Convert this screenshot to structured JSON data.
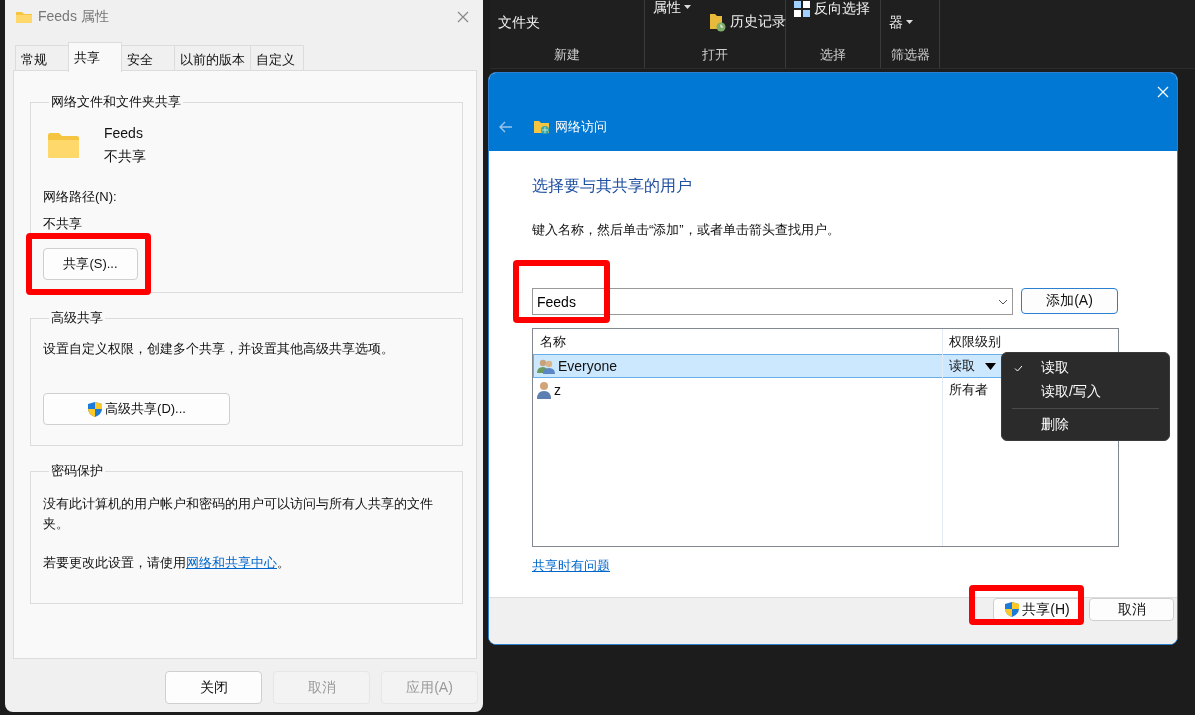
{
  "ribbon": {
    "groups": [
      {
        "label": "新建",
        "buttons": [
          {
            "kind": "large",
            "lines": [
              "文件夹"
            ],
            "caret": false
          }
        ]
      },
      {
        "label": "打开",
        "buttons": [
          {
            "kind": "large",
            "lines": [
              "属性"
            ],
            "caret": true
          },
          {
            "kind": "small",
            "label": "历史记录"
          }
        ]
      },
      {
        "label": "选择",
        "buttons": [
          {
            "kind": "small",
            "label": "反向选择"
          }
        ]
      },
      {
        "label": "筛选器",
        "buttons": [
          {
            "kind": "large",
            "lines": [
              "器"
            ],
            "caret": true
          }
        ]
      }
    ]
  },
  "properties_dialog": {
    "title": "Feeds 属性",
    "tabs": [
      {
        "label": "常规",
        "selected": false
      },
      {
        "label": "共享",
        "selected": true
      },
      {
        "label": "安全",
        "selected": false
      },
      {
        "label": "以前的版本",
        "selected": false
      },
      {
        "label": "自定义",
        "selected": false
      }
    ],
    "sharing_group": {
      "legend": "网络文件和文件夹共享",
      "item_name": "Feeds",
      "item_status": "不共享",
      "path_label": "网络路径(N):",
      "path_value": "不共享",
      "button": {
        "label": "共享(S)...",
        "highlighted": true
      }
    },
    "advanced_group": {
      "legend": "高级共享",
      "description": "设置自定义权限，创建多个共享，并设置其他高级共享选项。",
      "button": {
        "label": "高级共享(D)...",
        "shield": true
      }
    },
    "password_group": {
      "legend": "密码保护",
      "text": "没有此计算机的用户帐户和密码的用户可以访问与所有人共享的文件夹。",
      "note_before": "若要更改此设置，请使用",
      "link": "网络和共享中心",
      "note_after": "。"
    },
    "buttons": [
      {
        "label": "关闭",
        "disabled": false
      },
      {
        "label": "取消",
        "disabled": true
      },
      {
        "label": "应用(A)",
        "disabled": true
      }
    ]
  },
  "share_dialog": {
    "title": "网络访问",
    "heading": "选择要与其共享的用户",
    "instruction": "键入名称，然后单击“添加”，或者单击箭头查找用户。",
    "name_field": {
      "value": "Feeds",
      "highlighted": true
    },
    "add_button": "添加(A)",
    "columns": [
      "名称",
      "权限级别"
    ],
    "rows": [
      {
        "kind": "group",
        "name": "Everyone",
        "permission": "读取",
        "dropdown": true,
        "selected": true
      },
      {
        "kind": "user",
        "name": "z",
        "permission": "所有者",
        "dropdown": false,
        "selected": false
      }
    ],
    "menu": {
      "items": [
        {
          "label": "读取",
          "checked": true,
          "separator_before": false
        },
        {
          "label": "读取/写入",
          "checked": false,
          "separator_before": false
        },
        {
          "label": "删除",
          "checked": false,
          "separator_before": true
        }
      ]
    },
    "link": "共享时有问题",
    "buttons": [
      {
        "label": "共享(H)",
        "shield": true,
        "highlighted": true
      },
      {
        "label": "取消",
        "shield": false,
        "highlighted": false
      }
    ]
  }
}
